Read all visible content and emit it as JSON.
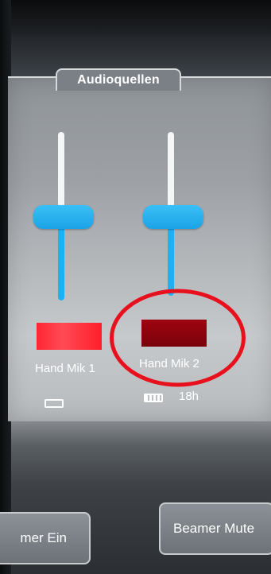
{
  "panel": {
    "title": "Audioquellen"
  },
  "channels": [
    {
      "label": "Hand Mik 1",
      "level": 0.5,
      "meter_color": "#ff2533",
      "battery_icon": "battery-empty-icon",
      "battery_time": ""
    },
    {
      "label": "Hand Mik 2",
      "level": 0.55,
      "meter_color": "#8a0410",
      "battery_icon": "battery-full-icon",
      "battery_time": "18h"
    }
  ],
  "buttons": {
    "left_label": "mer Ein",
    "right_label": "Beamer Mute"
  },
  "colors": {
    "accent": "#1fb0f0",
    "annotation": "#e8101c"
  }
}
